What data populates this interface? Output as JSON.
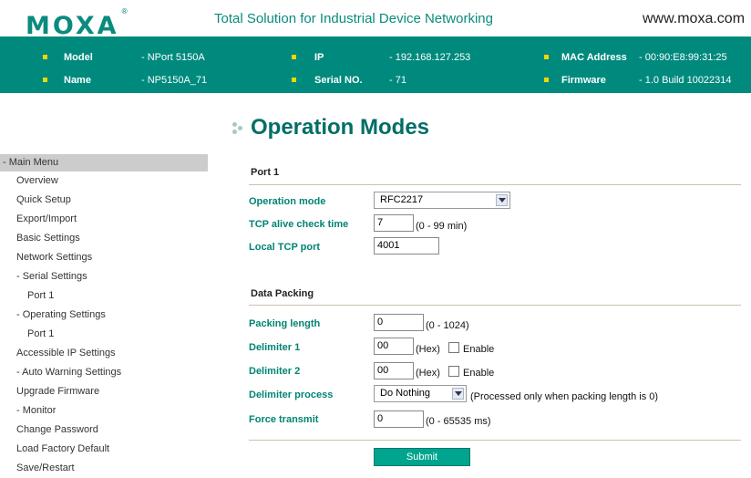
{
  "header": {
    "logo_text": "MOXA",
    "logo_mark": "®",
    "tagline": "Total Solution for Industrial Device Networking",
    "website": "www.moxa.com"
  },
  "info": {
    "model_label": "Model",
    "model_value": "- NPort 5150A",
    "name_label": "Name",
    "name_value": "- NP5150A_71",
    "ip_label": "IP",
    "ip_value": "- 192.168.127.253",
    "serial_label": "Serial NO.",
    "serial_value": "- 71",
    "mac_label": "MAC Address",
    "mac_value": "- 00:90:E8:99:31:25",
    "firmware_label": "Firmware",
    "firmware_value": "- 1.0 Build 10022314"
  },
  "sidebar": {
    "heading": "- Main Menu",
    "items": [
      {
        "label": "Overview"
      },
      {
        "label": "Quick Setup"
      },
      {
        "label": "Export/Import"
      },
      {
        "label": "Basic Settings"
      },
      {
        "label": "Network Settings"
      },
      {
        "label": "- Serial Settings"
      },
      {
        "label": "Port 1"
      },
      {
        "label": "- Operating Settings"
      },
      {
        "label": "Port 1"
      },
      {
        "label": "Accessible IP Settings"
      },
      {
        "label": "- Auto Warning Settings"
      },
      {
        "label": "Upgrade Firmware"
      },
      {
        "label": "- Monitor"
      },
      {
        "label": "Change Password"
      },
      {
        "label": "Load Factory Default"
      },
      {
        "label": "Save/Restart"
      }
    ]
  },
  "main": {
    "title": "Operation Modes",
    "port_section": "Port 1",
    "operation_mode_label": "Operation mode",
    "operation_mode_value": "RFC2217",
    "tcp_alive_label": "TCP alive check time",
    "tcp_alive_value": "7",
    "tcp_alive_hint": "(0 - 99 min)",
    "local_port_label": "Local TCP port",
    "local_port_value": "4001",
    "packing_section": "Data Packing",
    "packing_length_label": "Packing length",
    "packing_length_value": "0",
    "packing_length_hint": "(0 - 1024)",
    "delimiter1_label": "Delimiter 1",
    "delimiter1_value": "00",
    "delimiter1_hex": "(Hex)",
    "delimiter1_enable": "Enable",
    "delimiter2_label": "Delimiter 2",
    "delimiter2_value": "00",
    "delimiter2_hex": "(Hex)",
    "delimiter2_enable": "Enable",
    "delimiter_process_label": "Delimiter process",
    "delimiter_process_value": "Do Nothing",
    "delimiter_process_hint": "(Processed only when packing length is 0)",
    "force_transmit_label": "Force transmit",
    "force_transmit_value": "0",
    "force_transmit_hint": "(0 - 65535 ms)",
    "submit_label": "Submit"
  },
  "colors": {
    "brand": "#008a7e",
    "label": "#008474",
    "bullet": "#f7d700",
    "button": "#00a58f"
  },
  "icons": {
    "bullet": "square-bullet-icon",
    "select": "chevron-down-icon",
    "title": "dots-icon"
  }
}
